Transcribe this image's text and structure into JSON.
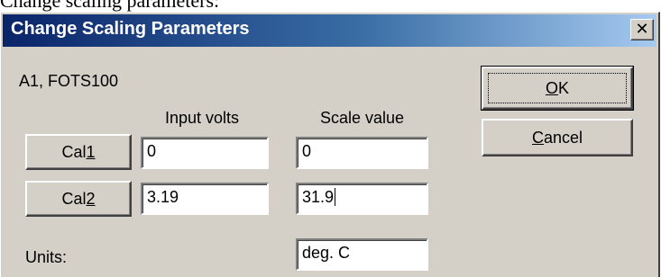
{
  "caption": "Change scaling parameters:",
  "dialog": {
    "title": "Change Scaling Parameters",
    "close_symbol": "✕"
  },
  "channel_label": "A1, FOTS100",
  "columns": {
    "input_volts": "Input volts",
    "scale_value": "Scale value"
  },
  "cal1": {
    "label_prefix": "Cal",
    "label_accel": "1",
    "input_volts": "0",
    "scale_value": "0"
  },
  "cal2": {
    "label_prefix": "Cal",
    "label_accel": "2",
    "input_volts": "3.19",
    "scale_value": "31.9"
  },
  "units": {
    "label": "Units:",
    "value": "deg. C"
  },
  "buttons": {
    "ok_accel": "O",
    "ok_rest": "K",
    "cancel_accel": "C",
    "cancel_rest": "ancel"
  },
  "colors": {
    "titlebar_start": "#0a246a",
    "titlebar_end": "#a6caf0",
    "face": "#d4d0c8"
  }
}
